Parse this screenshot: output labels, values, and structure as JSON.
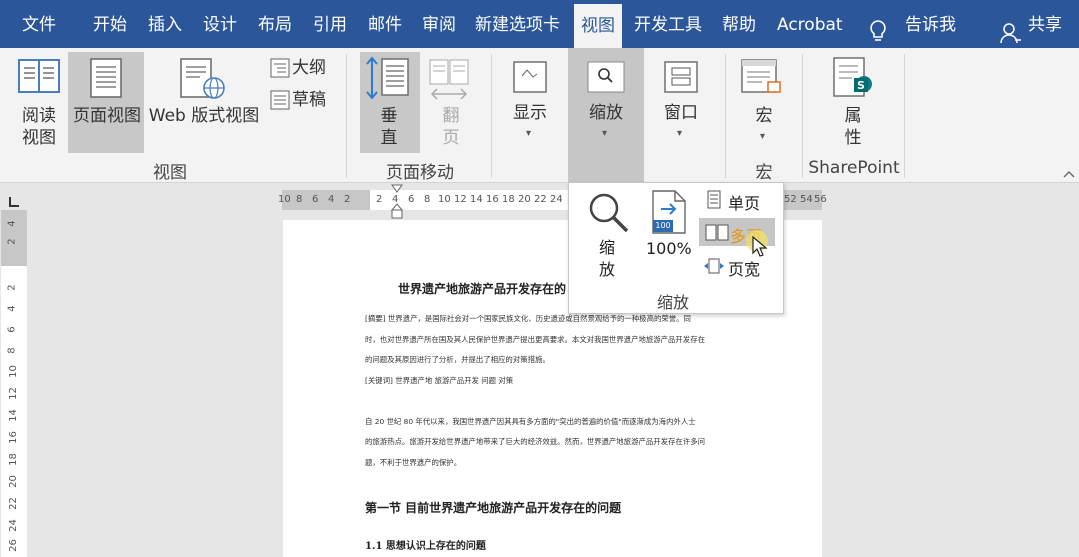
{
  "tabs": [
    "文件",
    "开始",
    "插入",
    "设计",
    "布局",
    "引用",
    "邮件",
    "审阅",
    "新建选项卡",
    "视图",
    "开发工具",
    "帮助",
    "Acrobat",
    "告诉我",
    "共享"
  ],
  "active_tab": "视图",
  "icons": {
    "lightbulb": "lightbulb-icon",
    "person": "person-icon",
    "magnifier": "magnifier-icon"
  },
  "ribbon": {
    "views": {
      "read_mode": [
        "阅读",
        "视图"
      ],
      "print_layout": "页面视图",
      "web_layout": "Web 版式视图",
      "outline": "大纲",
      "draft": "草稿",
      "group_label": "视图"
    },
    "page_movement": {
      "vertical": [
        "垂",
        "直"
      ],
      "side_to_side": [
        "翻",
        "页"
      ],
      "group_label": "页面移动"
    },
    "show": "显示",
    "zoom": "缩放",
    "window": "窗口",
    "macros": {
      "label": "宏",
      "group_label": "宏"
    },
    "sharepoint": {
      "label": [
        "属",
        "性"
      ],
      "group_label": "SharePoint"
    }
  },
  "zoom_dropdown": {
    "zoom": [
      "缩",
      "放"
    ],
    "hundred_badge": "100",
    "hundred": "100%",
    "one_page": "单页",
    "multiple_pages": "多页",
    "page_width": "页宽",
    "group_label": "缩放"
  },
  "ruler": {
    "left_numbers": [
      "10",
      "8",
      "6",
      "4",
      "2"
    ],
    "right_numbers": [
      "2",
      "4",
      "6",
      "8",
      "10",
      "12",
      "14",
      "16",
      "18",
      "20",
      "22",
      "24"
    ],
    "far_numbers": [
      "52",
      "54",
      "56"
    ],
    "vertical_numbers": [
      "4",
      "2",
      "2",
      "4",
      "6",
      "8",
      "10",
      "12",
      "14",
      "16",
      "18",
      "20",
      "22",
      "24",
      "26"
    ]
  },
  "document": {
    "title": "世界遗产地旅游产品开发存在的",
    "abstract_lines": [
      "[摘要] 世界遗产，是国际社会对一个国家民族文化、历史遗迹或自然景观给予的一种极高的荣誉。同",
      "时，也对世界遗产所在国及其人民保护世界遗产提出更高要求。本文对我国世界遗产地旅游产品开发存在",
      "的问题及其原因进行了分析，并提出了相应的对策措施。",
      "[关键词] 世界遗产地  旅游产品开发  问题  对策"
    ],
    "body_lines": [
      "自 20 世纪 80 年代以来，我国世界遗产因其具有多方面的\"突出的普遍的价值\"而逐渐成为海内外人士",
      "的旅游热点。旅游开发给世界遗产地带来了巨大的经济效益。然而，世界遗产地旅游产品开发存在许多问",
      "题，不利于世界遗产的保护。"
    ],
    "section_title": "第一节    目前世界遗产地旅游产品开发存在的问题",
    "subsection_title": "1.1  思想认识上存在的问题"
  }
}
